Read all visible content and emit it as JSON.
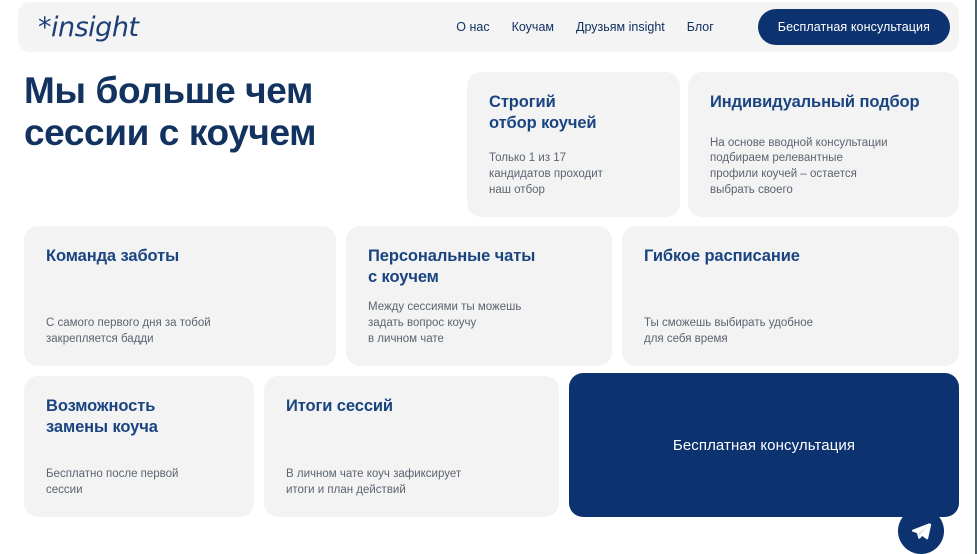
{
  "header": {
    "logo_text": "*insight",
    "nav_items": [
      {
        "label": "О нас"
      },
      {
        "label": "Коучам"
      },
      {
        "label": "Друзьям insight"
      },
      {
        "label": "Блог"
      }
    ],
    "cta_label": "Бесплатная консультация"
  },
  "hero": {
    "title": "Мы больше\nчем сессии\nс коучем"
  },
  "cards": [
    {
      "id": "strict",
      "title": "Строгий\nотбор коучей",
      "body": "Только 1 из 17\nкандидатов проходит\nнаш отбор"
    },
    {
      "id": "individual",
      "title": "Индивидуальный подбор",
      "body": "На основе вводной консультации\nподбираем релевантные\nпрофили коучей – остается\nвыбрать своего"
    },
    {
      "id": "care",
      "title": "Команда заботы",
      "body": "С самого первого дня за тобой\nзакрепляется бадди"
    },
    {
      "id": "chats",
      "title": "Персональные чаты\nс коучем",
      "body": "Между сессиями ты можешь\nзадать вопрос коучу\nв личном чате"
    },
    {
      "id": "schedule",
      "title": "Гибкое расписание",
      "body": "Ты сможешь выбирать удобное\nдля себя время"
    },
    {
      "id": "replace",
      "title": "Возможность\nзамены коуча",
      "body": "Бесплатно после первой\nсессии"
    },
    {
      "id": "results",
      "title": "Итоги сессий",
      "body": "В личном чате коуч зафиксирует\nитоги и план действий"
    }
  ],
  "consult_card": {
    "label": "Бесплатная консультация"
  },
  "floating_action": {
    "icon": "telegram-icon"
  },
  "colors": {
    "brand_dark_blue": "#0d3270",
    "heading_blue": "#123260",
    "card_title_blue": "#1a4480",
    "card_background": "#f3f3f4",
    "header_background": "#f4f4f5",
    "body_text_gray": "#5b6470",
    "page_background": "#ffffff"
  }
}
